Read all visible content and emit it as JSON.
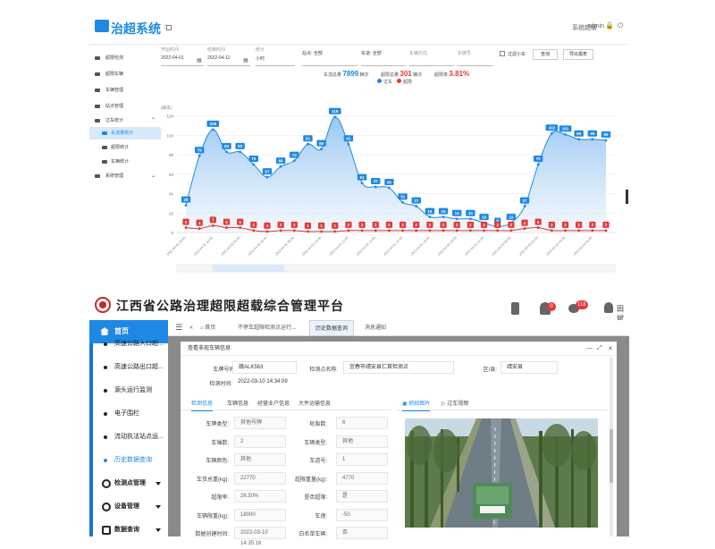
{
  "p1": {
    "brand": "治超系统",
    "user": {
      "role": "系统超级",
      "name": "admin"
    },
    "sidebar": [
      "超限检测",
      "超限车辆",
      "车辆管理",
      "站点管理",
      "过车统计",
      "车流量统计",
      "超限统计",
      "车辆统计",
      "系统管理"
    ],
    "filters": {
      "start": {
        "label": "开始时间",
        "value": "2022-04-01"
      },
      "end": {
        "label": "结束时间",
        "value": "2022-04-12"
      },
      "period": {
        "label": "统计",
        "value": "小时"
      },
      "site": "站点: 全部",
      "lane": "车道: 全部",
      "direction": "车辆方向",
      "plate": "车牌号",
      "exclude_label": "过滤小车",
      "btn_search": "查询",
      "btn_export": "导出报表"
    },
    "summary": {
      "total_label": "车流总量",
      "total": "7899",
      "unit1": "辆次",
      "over_label": "超限总量",
      "over": "301",
      "unit2": "辆次",
      "rate_label": "超限率",
      "rate": "3.81%"
    }
  },
  "chart_data": {
    "type": "area",
    "ylabel": "(辆次)",
    "ylim": [
      0,
      140
    ],
    "yticks": [
      0,
      20,
      40,
      60,
      80,
      100,
      120
    ],
    "legend": [
      "过车",
      "超限"
    ],
    "colors": {
      "total": "#1e88e5",
      "over": "#e53935"
    },
    "x": [
      "2022-04-02 00:00",
      "2022-04-02 01:00",
      "2022-04-02 02:00",
      "2022-04-02 03:00",
      "2022-04-02 04:00",
      "2022-04-02 05:00",
      "2022-04-02 06:00",
      "2022-04-02 07:00",
      "2022-04-02 08:00",
      "2022-04-02 09:00",
      "2022-04-02 10:00",
      "2022-04-02 11:00",
      "2022-04-02 12:00",
      "2022-04-02 13:00",
      "2022-04-02 14:00",
      "2022-04-02 15:00",
      "2022-04-02 16:00",
      "2022-04-02 17:00",
      "2022-04-02 18:00",
      "2022-04-02 19:00",
      "2022-04-02 20:00",
      "2022-04-02 21:00",
      "2022-04-02 22:00",
      "2022-04-02 23:00",
      "2022-04-03 00:00",
      "2022-04-03 01:00",
      "2022-04-03 02:00",
      "2022-04-03 03:00",
      "2022-04-03 04:00",
      "2022-04-03 05:00",
      "2022-04-03 06:00",
      "2022-04-03 07:00"
    ],
    "series": [
      {
        "name": "过车",
        "values": [
          28,
          79,
          106,
          83,
          83,
          70,
          57,
          68,
          74,
          91,
          86,
          119,
          91,
          51,
          47,
          46,
          31,
          27,
          16,
          16,
          14,
          14,
          10,
          6,
          10,
          27,
          70,
          102,
          101,
          96,
          96,
          95
        ]
      },
      {
        "name": "超限",
        "values": [
          5,
          4,
          7,
          5,
          5,
          2,
          1,
          2,
          2,
          1,
          1,
          1,
          2,
          2,
          2,
          2,
          2,
          2,
          2,
          2,
          2,
          2,
          2,
          2,
          2,
          4,
          5,
          2,
          2,
          2,
          2,
          2
        ]
      }
    ]
  },
  "p2": {
    "title": "江西省公路治理超限超载综合管理平台",
    "badges": {
      "alerts": "0",
      "messages": "118"
    },
    "user": "田斌",
    "home": "首页",
    "menu": [
      "高速公路入口超...",
      "高速公路出口超...",
      "源头运行监测",
      "电子围栏",
      "流动执法站点运...",
      "历史数据查询"
    ],
    "groups": [
      "检测点管理",
      "设备管理",
      "数据查询"
    ],
    "tabs": [
      "首页",
      "不停车超限检测点运行...",
      "历史数据查询",
      "消息通知"
    ],
    "modal": {
      "title": "查看非现车辆信息",
      "plate_label": "车牌号码:",
      "plate": "赣ALK563",
      "site_label": "检测点名称:",
      "site": "宜春市靖安县仁首检测点",
      "area_label": "区/县:",
      "area": "靖安县",
      "time_label": "检测时间:",
      "time": "2022-03-10 14:34:09",
      "subtabs": [
        "检测信息",
        "车辆信息",
        "经营业户信息",
        "大件运输信息"
      ],
      "photo_tabs": [
        "抓拍图片",
        "过车视频"
      ],
      "fields_left": [
        {
          "label": "车牌类型:",
          "value": "其他号牌"
        },
        {
          "label": "车轴数:",
          "value": "2"
        },
        {
          "label": "车辆颜色:",
          "value": "其他"
        },
        {
          "label": "车货总重(kg):",
          "value": "22770"
        },
        {
          "label": "超限率:",
          "value": "26.50%"
        },
        {
          "label": "车辆限重(kg):",
          "value": "18000"
        },
        {
          "label": "数据创建时间:",
          "value": "2022-03-10 14:35:16"
        }
      ],
      "fields_right": [
        {
          "label": "轮胎数:",
          "value": "6"
        },
        {
          "label": "车辆类型:",
          "value": "其他"
        },
        {
          "label": "车道号:",
          "value": "1"
        },
        {
          "label": "超限重量(kg):",
          "value": "4770"
        },
        {
          "label": "是否超限:",
          "value": "是"
        },
        {
          "label": "车速:",
          "value": "-50"
        },
        {
          "label": "白名单车辆:",
          "value": "否"
        }
      ]
    }
  }
}
